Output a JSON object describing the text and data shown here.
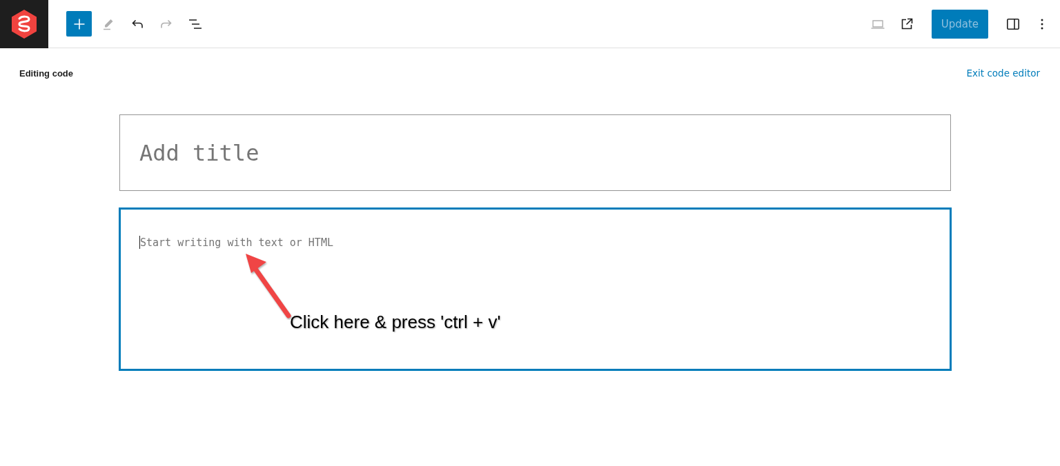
{
  "toolbar": {
    "left_tools": [
      {
        "kind": "add",
        "disabled": false
      },
      {
        "kind": "edit",
        "disabled": true
      },
      {
        "kind": "undo",
        "disabled": false
      },
      {
        "kind": "redo",
        "disabled": true
      },
      {
        "kind": "list",
        "disabled": false
      }
    ],
    "right_tools": [
      {
        "kind": "preview",
        "disabled": true
      },
      {
        "kind": "view",
        "disabled": false
      }
    ],
    "update_button": {
      "label": "Update",
      "disabled": true
    },
    "end_tools": [
      {
        "kind": "sidebar",
        "disabled": false
      },
      {
        "kind": "more",
        "disabled": false
      }
    ]
  },
  "code_editor": {
    "heading": "Editing code",
    "exit_link": "Exit code editor",
    "title_placeholder": "Add title",
    "content_placeholder": "Start writing with text or HTML",
    "content_focused": true
  },
  "annotation": {
    "text": "Click here & press 'ctrl + v'"
  }
}
